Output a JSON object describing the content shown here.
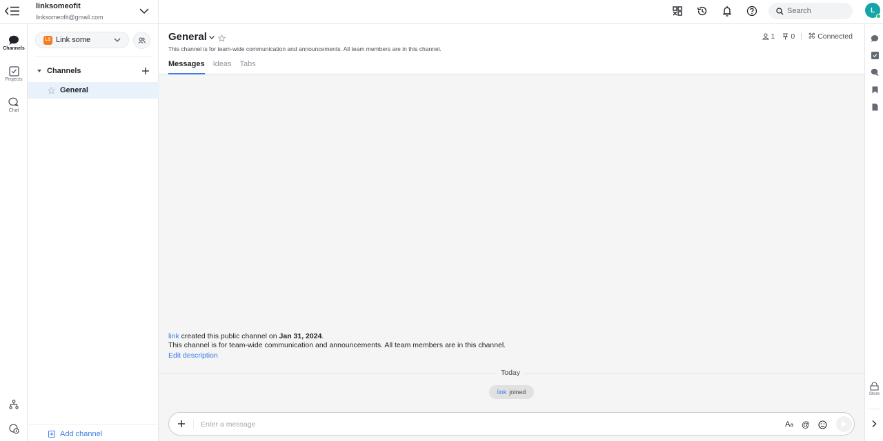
{
  "topbar": {
    "menu_icon": "collapse-menu-icon",
    "account_name": "linksomeofit",
    "account_email": "linksomeofit@gmail.com",
    "icons": [
      "apps-grid-icon",
      "history-icon",
      "bell-icon",
      "help-icon"
    ],
    "search_placeholder": "Search",
    "avatar_initial": "L",
    "avatar_color": "#14a5a8",
    "online_color": "#25c46a"
  },
  "rail": {
    "items": [
      {
        "label": "Channels",
        "icon": "channels-icon",
        "active": true
      },
      {
        "label": "Projects",
        "icon": "projects-icon",
        "active": false
      },
      {
        "label": "Chat",
        "icon": "chat-icon",
        "active": false
      }
    ],
    "bottom_icons": [
      "org-chart-icon",
      "apps-info-icon"
    ]
  },
  "sidebar": {
    "workspace_badge": "LS",
    "workspace_name": "Link some",
    "section_title": "Channels",
    "channels": [
      {
        "name": "General",
        "selected": true
      }
    ],
    "add_channel_label": "Add channel"
  },
  "channel": {
    "title": "General",
    "description": "This channel is for team-wide communication and announcements. All team members are in this channel.",
    "tabs": [
      {
        "label": "Messages",
        "active": true
      },
      {
        "label": "Ideas",
        "active": false
      },
      {
        "label": "Tabs",
        "active": false
      }
    ],
    "member_count": "1",
    "pinned_count": "0",
    "connection_status": "Connected"
  },
  "messages": {
    "intro_user": "link",
    "intro_text": " created this public channel on ",
    "intro_date": "Jan 31, 2024",
    "intro_end": ".",
    "intro_description": "This channel is for team-wide communication and announcements. All team members are in this channel.",
    "edit_description_label": "Edit description",
    "day_divider": "Today",
    "join_user": "link",
    "join_text": "joined"
  },
  "composer": {
    "placeholder": "Enter a message",
    "value": ""
  },
  "right_rail": {
    "icons": [
      "messages-icon",
      "tasks-icon",
      "threads-icon",
      "bookmark-icon",
      "file-icon"
    ],
    "store_label": "Store"
  },
  "colors": {
    "accent": "#3c7be6",
    "workspace_badge": "#f77b1b",
    "selected_channel_bg": "#e9f1fb"
  }
}
